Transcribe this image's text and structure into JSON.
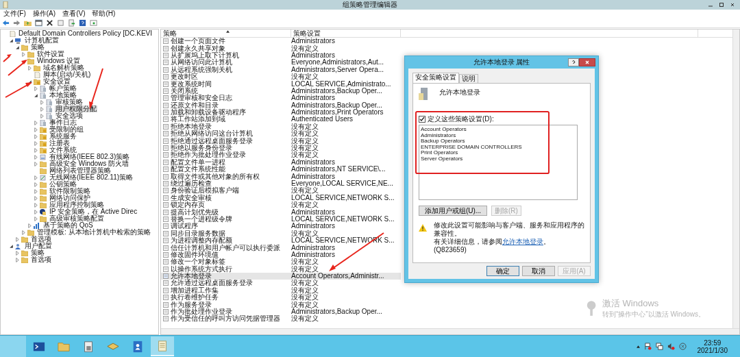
{
  "window": {
    "title": "组策略管理编辑器"
  },
  "menu": [
    "文件(F)",
    "操作(A)",
    "查看(V)",
    "帮助(H)"
  ],
  "tree": [
    {
      "label": "Default Domain Controllers Policy [DC.KEVI",
      "kind": "policy",
      "expandable": false,
      "expanded": true,
      "selected": false,
      "children": [
        {
          "label": "计算机配置",
          "kind": "computer",
          "expandable": true,
          "expanded": true,
          "selected": false,
          "children": [
            {
              "label": "策略",
              "kind": "folder",
              "expandable": true,
              "expanded": true,
              "selected": false,
              "children": [
                {
                  "label": "软件设置",
                  "kind": "folder",
                  "expandable": true,
                  "expanded": false,
                  "selected": false
                },
                {
                  "label": "Windows 设置",
                  "kind": "folder",
                  "expandable": true,
                  "expanded": true,
                  "selected": false,
                  "children": [
                    {
                      "label": "域名解析策略",
                      "kind": "folder",
                      "expandable": true,
                      "expanded": false,
                      "selected": false
                    },
                    {
                      "label": "脚本(启动/关机)",
                      "kind": "script",
                      "expandable": false,
                      "selected": false
                    },
                    {
                      "label": "安全设置",
                      "kind": "secure",
                      "expandable": true,
                      "expanded": true,
                      "selected": false,
                      "children": [
                        {
                          "label": "帐户策略",
                          "kind": "settings",
                          "expandable": true,
                          "expanded": false,
                          "selected": false
                        },
                        {
                          "label": "本地策略",
                          "kind": "settings",
                          "expandable": true,
                          "expanded": true,
                          "selected": false,
                          "children": [
                            {
                              "label": "审核策略",
                              "kind": "settings",
                              "expandable": true,
                              "expanded": false,
                              "selected": false
                            },
                            {
                              "label": "用户权限分配",
                              "kind": "settings",
                              "expandable": true,
                              "expanded": false,
                              "selected": true
                            },
                            {
                              "label": "安全选项",
                              "kind": "settings",
                              "expandable": true,
                              "expanded": false,
                              "selected": false
                            }
                          ]
                        },
                        {
                          "label": "事件日志",
                          "kind": "settings",
                          "expandable": true,
                          "expanded": false,
                          "selected": false
                        },
                        {
                          "label": "受限制的组",
                          "kind": "secure",
                          "expandable": true,
                          "expanded": false,
                          "selected": false
                        },
                        {
                          "label": "系统服务",
                          "kind": "secure",
                          "expandable": true,
                          "expanded": false,
                          "selected": false
                        },
                        {
                          "label": "注册表",
                          "kind": "secure",
                          "expandable": true,
                          "expanded": false,
                          "selected": false
                        },
                        {
                          "label": "文件系统",
                          "kind": "secure",
                          "expandable": true,
                          "expanded": false,
                          "selected": false
                        },
                        {
                          "label": "有线网络(IEEE 802.3)策略",
                          "kind": "network",
                          "expandable": true,
                          "expanded": false,
                          "selected": false
                        },
                        {
                          "label": "高级安全 Windows 防火墙",
                          "kind": "folder",
                          "expandable": true,
                          "expanded": false,
                          "selected": false
                        },
                        {
                          "label": "网络列表管理器策略",
                          "kind": "folder",
                          "expandable": false,
                          "selected": false
                        },
                        {
                          "label": "无线网络(IEEE 802.11)策略",
                          "kind": "wireless",
                          "expandable": true,
                          "expanded": false,
                          "selected": false
                        },
                        {
                          "label": "公钥策略",
                          "kind": "folder",
                          "expandable": true,
                          "expanded": false,
                          "selected": false
                        },
                        {
                          "label": "软件限制策略",
                          "kind": "folder",
                          "expandable": true,
                          "expanded": false,
                          "selected": false
                        },
                        {
                          "label": "网络访问保护",
                          "kind": "folder",
                          "expandable": true,
                          "expanded": false,
                          "selected": false
                        },
                        {
                          "label": "应用程序控制策略",
                          "kind": "folder",
                          "expandable": true,
                          "expanded": false,
                          "selected": false
                        },
                        {
                          "label": "IP 安全策略，在 Active Direc",
                          "kind": "shield",
                          "expandable": true,
                          "expanded": false,
                          "selected": false
                        },
                        {
                          "label": "高级审核策略配置",
                          "kind": "folder",
                          "expandable": true,
                          "expanded": false,
                          "selected": false
                        }
                      ]
                    },
                    {
                      "label": "基于策略的 QoS",
                      "kind": "chart",
                      "expandable": true,
                      "expanded": false,
                      "selected": false
                    }
                  ]
                },
                {
                  "label": "管理模板: 从本地计算机中检索的策略",
                  "kind": "folder",
                  "expandable": true,
                  "expanded": false,
                  "selected": false
                }
              ]
            },
            {
              "label": "首选项",
              "kind": "folder",
              "expandable": true,
              "expanded": false,
              "selected": false
            }
          ]
        },
        {
          "label": "用户配置",
          "kind": "user",
          "expandable": true,
          "expanded": true,
          "selected": false,
          "children": [
            {
              "label": "策略",
              "kind": "folder",
              "expandable": true,
              "expanded": false,
              "selected": false
            },
            {
              "label": "首选项",
              "kind": "folder",
              "expandable": true,
              "expanded": false,
              "selected": false
            }
          ]
        }
      ]
    }
  ],
  "list": {
    "columns": [
      {
        "label": "策略",
        "sorted": true
      },
      {
        "label": "策略设置",
        "sorted": false
      }
    ],
    "rows": [
      {
        "name": "创建一个页面文件",
        "setting": "Administrators",
        "selected": false
      },
      {
        "name": "创建永久共享对象",
        "setting": "没有定义",
        "selected": false
      },
      {
        "name": "从扩展坞上取下计算机",
        "setting": "Administrators",
        "selected": false
      },
      {
        "name": "从网络访问此计算机",
        "setting": "Everyone,Administrators,Aut...",
        "selected": false
      },
      {
        "name": "从远程系统强制关机",
        "setting": "Administrators,Server Opera...",
        "selected": false
      },
      {
        "name": "更改时区",
        "setting": "没有定义",
        "selected": false
      },
      {
        "name": "更改系统时间",
        "setting": "LOCAL SERVICE,Administrato...",
        "selected": false
      },
      {
        "name": "关闭系统",
        "setting": "Administrators,Backup Oper...",
        "selected": false
      },
      {
        "name": "管理审核和安全日志",
        "setting": "Administrators",
        "selected": false
      },
      {
        "name": "还原文件和目录",
        "setting": "Administrators,Backup Oper...",
        "selected": false
      },
      {
        "name": "加载和卸载设备驱动程序",
        "setting": "Administrators,Print Operators",
        "selected": false
      },
      {
        "name": "将工作站添加到域",
        "setting": "Authenticated Users",
        "selected": false
      },
      {
        "name": "拒绝本地登录",
        "setting": "没有定义",
        "selected": false
      },
      {
        "name": "拒绝从网络访问这台计算机",
        "setting": "没有定义",
        "selected": false
      },
      {
        "name": "拒绝通过远程桌面服务登录",
        "setting": "没有定义",
        "selected": false
      },
      {
        "name": "拒绝以服务身份登录",
        "setting": "没有定义",
        "selected": false
      },
      {
        "name": "拒绝作为批处理作业登录",
        "setting": "没有定义",
        "selected": false
      },
      {
        "name": "配置文件单一进程",
        "setting": "Administrators",
        "selected": false
      },
      {
        "name": "配置文件系统性能",
        "setting": "Administrators,NT SERVICE\\...",
        "selected": false
      },
      {
        "name": "取得文件或其他对象的所有权",
        "setting": "Administrators",
        "selected": false
      },
      {
        "name": "绕过遍历检查",
        "setting": "Everyone,LOCAL SERVICE,NE...",
        "selected": false
      },
      {
        "name": "身份验证后模拟客户端",
        "setting": "没有定义",
        "selected": false
      },
      {
        "name": "生成安全审核",
        "setting": "LOCAL SERVICE,NETWORK S...",
        "selected": false
      },
      {
        "name": "锁定内存页",
        "setting": "没有定义",
        "selected": false
      },
      {
        "name": "提高计划优先级",
        "setting": "Administrators",
        "selected": false
      },
      {
        "name": "替换一个进程级令牌",
        "setting": "LOCAL SERVICE,NETWORK S...",
        "selected": false
      },
      {
        "name": "调试程序",
        "setting": "Administrators",
        "selected": false
      },
      {
        "name": "同步目录服务数据",
        "setting": "没有定义",
        "selected": false
      },
      {
        "name": "为进程调整内存配额",
        "setting": "LOCAL SERVICE,NETWORK S...",
        "selected": false
      },
      {
        "name": "信任计算机和用户帐户可以执行委派",
        "setting": "Administrators",
        "selected": false
      },
      {
        "name": "修改固件环境值",
        "setting": "Administrators",
        "selected": false
      },
      {
        "name": "修改一个对象标签",
        "setting": "没有定义",
        "selected": false
      },
      {
        "name": "以操作系统方式执行",
        "setting": "没有定义",
        "selected": false
      },
      {
        "name": "允许本地登录",
        "setting": "Account Operators,Administr...",
        "selected": true
      },
      {
        "name": "允许通过远程桌面服务登录",
        "setting": "没有定义",
        "selected": false
      },
      {
        "name": "增加进程工作集",
        "setting": "没有定义",
        "selected": false
      },
      {
        "name": "执行卷维护任务",
        "setting": "没有定义",
        "selected": false
      },
      {
        "name": "作为服务登录",
        "setting": "没有定义",
        "selected": false
      },
      {
        "name": "作为批处理作业登录",
        "setting": "Administrators,Backup Oper...",
        "selected": false
      },
      {
        "name": "作为受信任的呼叫方访问凭据管理器",
        "setting": "没有定义",
        "selected": false
      }
    ]
  },
  "dialog": {
    "title": "允许本地登录 属性",
    "tabs": [
      {
        "label": "安全策略设置",
        "selected": true
      },
      {
        "label": "说明",
        "selected": false
      }
    ],
    "policy_name": "允许本地登录",
    "define_checkbox": {
      "label": "定义这些策略设置(D):",
      "checked": true
    },
    "members": [
      "Account Operators",
      "Administrators",
      "Backup Operators",
      "ENTERPRISE DOMAIN CONTROLLERS",
      "Print Operators",
      "Server Operators"
    ],
    "add_button": {
      "label": "添加用户或组(U)...",
      "disabled": false
    },
    "remove_button": {
      "label": "删除(R)",
      "disabled": true
    },
    "warning_line1": "修改此设置可能影响与客户端、服务和应用程序的兼容性。",
    "warning_line2": "有关详细信息，请参阅",
    "warning_link": "允许本地登录",
    "warning_line2_end": "。 (Q823659)",
    "buttons": [
      {
        "label": "确定",
        "disabled": false
      },
      {
        "label": "取消",
        "disabled": false
      },
      {
        "label": "应用(A)",
        "disabled": true
      }
    ]
  },
  "activation_notice": {
    "title": "激活 Windows",
    "text": "转到“操作中心”以激活 Windows。"
  },
  "taskbar": {
    "apps": [
      {
        "kind": "powershell",
        "active": false
      },
      {
        "kind": "explorer",
        "active": false
      },
      {
        "kind": "tool",
        "active": false
      },
      {
        "kind": "books",
        "active": false
      },
      {
        "kind": "contacts",
        "active": false
      },
      {
        "kind": "notepad",
        "active": true
      }
    ],
    "time": "23:59",
    "date": "2021/1/30"
  }
}
